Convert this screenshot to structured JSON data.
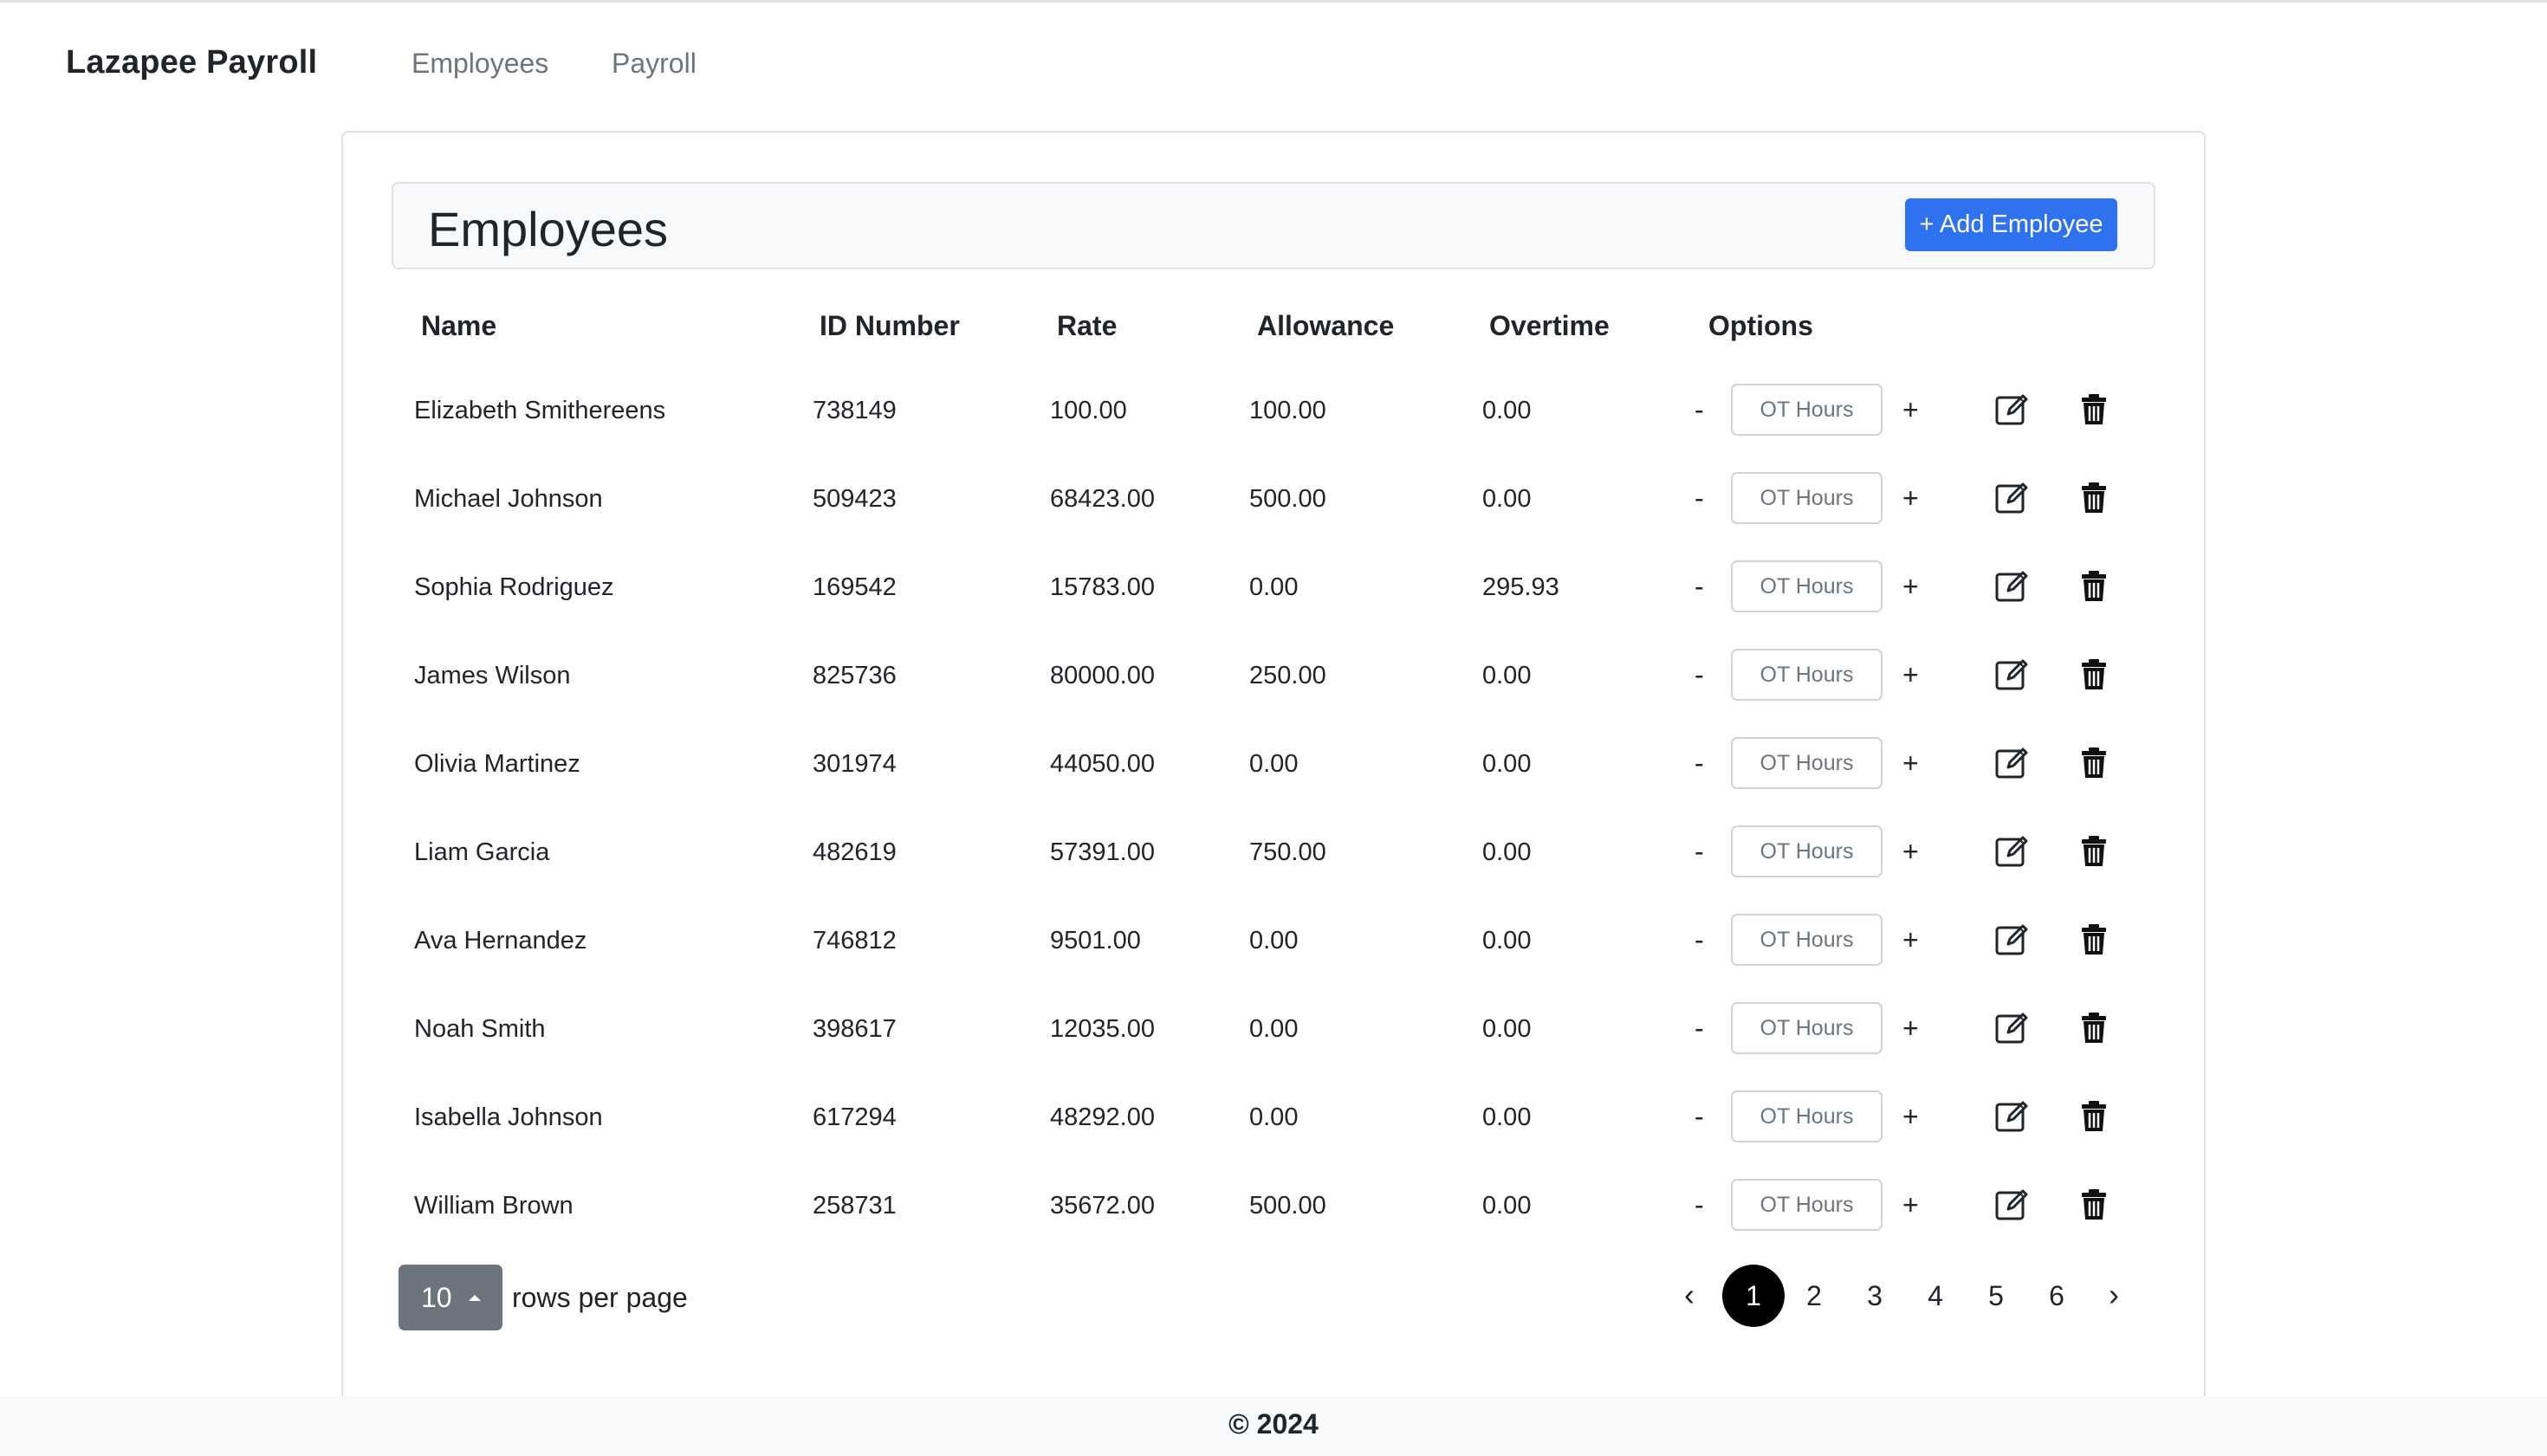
{
  "navbar": {
    "brand": "Lazapee Payroll",
    "links": [
      "Employees",
      "Payroll"
    ]
  },
  "card": {
    "title": "Employees",
    "add_button": "+ Add Employee"
  },
  "table": {
    "headers": [
      "Name",
      "ID Number",
      "Rate",
      "Allowance",
      "Overtime",
      "Options"
    ],
    "ot_placeholder": "OT Hours",
    "minus_label": "-",
    "plus_label": "+",
    "rows": [
      {
        "name": "Elizabeth Smithereens",
        "id": "738149",
        "rate": "100.00",
        "allowance": "100.00",
        "overtime": "0.00"
      },
      {
        "name": "Michael Johnson",
        "id": "509423",
        "rate": "68423.00",
        "allowance": "500.00",
        "overtime": "0.00"
      },
      {
        "name": "Sophia Rodriguez",
        "id": "169542",
        "rate": "15783.00",
        "allowance": "0.00",
        "overtime": "295.93"
      },
      {
        "name": "James Wilson",
        "id": "825736",
        "rate": "80000.00",
        "allowance": "250.00",
        "overtime": "0.00"
      },
      {
        "name": "Olivia Martinez",
        "id": "301974",
        "rate": "44050.00",
        "allowance": "0.00",
        "overtime": "0.00"
      },
      {
        "name": "Liam Garcia",
        "id": "482619",
        "rate": "57391.00",
        "allowance": "750.00",
        "overtime": "0.00"
      },
      {
        "name": "Ava Hernandez",
        "id": "746812",
        "rate": "9501.00",
        "allowance": "0.00",
        "overtime": "0.00"
      },
      {
        "name": "Noah Smith",
        "id": "398617",
        "rate": "12035.00",
        "allowance": "0.00",
        "overtime": "0.00"
      },
      {
        "name": "Isabella Johnson",
        "id": "617294",
        "rate": "48292.00",
        "allowance": "0.00",
        "overtime": "0.00"
      },
      {
        "name": "William Brown",
        "id": "258731",
        "rate": "35672.00",
        "allowance": "500.00",
        "overtime": "0.00"
      }
    ]
  },
  "pagination": {
    "rows_per_page_value": "10",
    "rows_per_page_label": "rows per page",
    "prev": "‹",
    "next": "›",
    "pages": [
      "1",
      "2",
      "3",
      "4",
      "5",
      "6"
    ],
    "active_page": "1"
  },
  "footer": {
    "text": "© 2024"
  }
}
